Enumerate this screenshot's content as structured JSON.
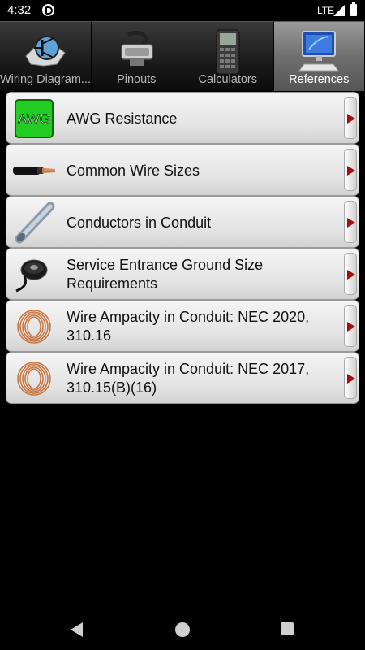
{
  "status_bar": {
    "time": "4:32",
    "network": "LTE"
  },
  "tabs": [
    {
      "label": "Wiring Diagram...",
      "icon": "transistor-diagram-icon",
      "active": false
    },
    {
      "label": "Pinouts",
      "icon": "connector-cable-icon",
      "active": false
    },
    {
      "label": "Calculators",
      "icon": "calculator-icon",
      "active": false
    },
    {
      "label": "References",
      "icon": "computer-monitor-icon",
      "active": true
    }
  ],
  "list": [
    {
      "label": "AWG Resistance",
      "icon": "awg-icon",
      "icon_text": "AWG"
    },
    {
      "label": "Common Wire Sizes",
      "icon": "wire-cable-icon"
    },
    {
      "label": "Conductors in Conduit",
      "icon": "conduit-pipe-icon"
    },
    {
      "label": "Service Entrance Ground Size Requirements",
      "icon": "wire-spool-icon"
    },
    {
      "label": "Wire Ampacity in Conduit: NEC 2020, 310.16",
      "icon": "copper-coil-icon"
    },
    {
      "label": "Wire Ampacity in Conduit: NEC 2017, 310.15(B)(16)",
      "icon": "copper-coil-icon"
    }
  ],
  "colors": {
    "arrow": "#a31010",
    "awg_green": "#22cc22",
    "copper": "#c87843"
  }
}
